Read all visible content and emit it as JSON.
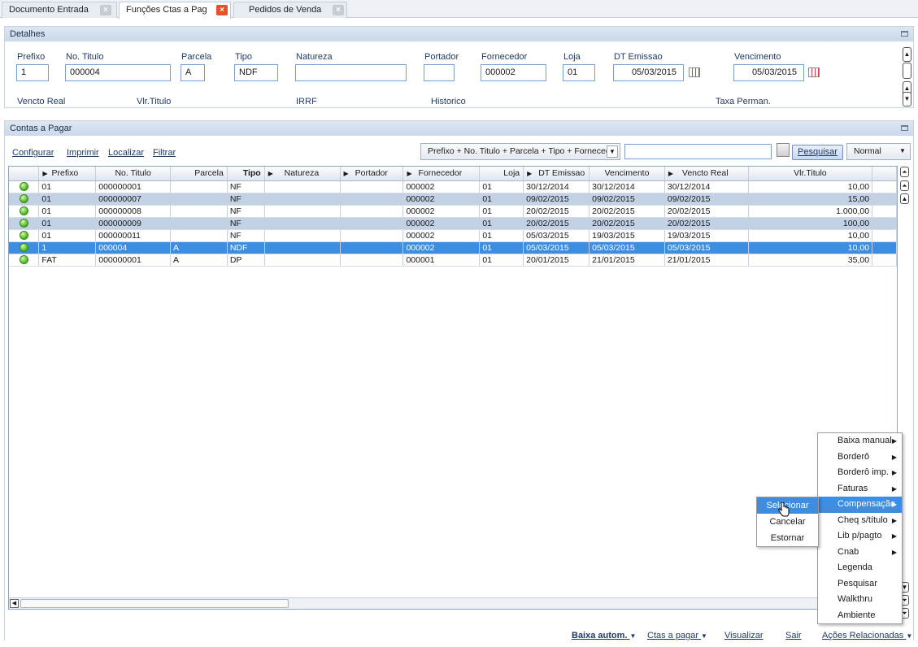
{
  "tabs": [
    {
      "label": "Documento Entrada"
    },
    {
      "label": "Funções Ctas a Pag"
    },
    {
      "label": "Pedidos de Venda"
    }
  ],
  "detalhes": {
    "title": "Detalhes",
    "fields": {
      "prefixo": {
        "label": "Prefixo",
        "value": "1"
      },
      "no_titulo": {
        "label": "No. Titulo",
        "value": "000004"
      },
      "parcela": {
        "label": "Parcela",
        "value": "A"
      },
      "tipo": {
        "label": "Tipo",
        "value": "NDF"
      },
      "natureza": {
        "label": "Natureza",
        "value": ""
      },
      "portador": {
        "label": "Portador",
        "value": ""
      },
      "fornecedor": {
        "label": "Fornecedor",
        "value": "000002"
      },
      "loja": {
        "label": "Loja",
        "value": "01"
      },
      "dt_emissao": {
        "label": "DT Emissao",
        "value": "05/03/2015"
      },
      "vencimento": {
        "label": "Vencimento",
        "value": "05/03/2015"
      }
    },
    "row2": {
      "vencto_real": "Vencto Real",
      "vlr_titulo": "Vlr.Titulo",
      "irrf": "IRRF",
      "historico": "Historico",
      "taxa_perman": "Taxa Perman."
    }
  },
  "contas": {
    "title": "Contas a Pagar",
    "links": {
      "configurar": "Configurar",
      "imprimir": "Imprimir",
      "localizar": "Localizar",
      "filtrar": "Filtrar"
    },
    "order_select": "Prefixo + No. Titulo + Parcela + Tipo + Fornecedo",
    "search_value": "",
    "search_button": "Pesquisar",
    "mode_select": "Normal"
  },
  "grid": {
    "columns": [
      "Prefixo",
      "No. Titulo",
      "Parcela",
      "Tipo",
      "Natureza",
      "Portador",
      "Fornecedor",
      "Loja",
      "DT Emissao",
      "Vencimento",
      "Vencto Real",
      "Vlr.Titulo"
    ],
    "rows": [
      [
        "01",
        "000000001",
        "",
        "NF",
        "",
        "",
        "000002",
        "01",
        "30/12/2014",
        "30/12/2014",
        "30/12/2014",
        "10,00"
      ],
      [
        "01",
        "000000007",
        "",
        "NF",
        "",
        "",
        "000002",
        "01",
        "09/02/2015",
        "09/02/2015",
        "09/02/2015",
        "15,00"
      ],
      [
        "01",
        "000000008",
        "",
        "NF",
        "",
        "",
        "000002",
        "01",
        "20/02/2015",
        "20/02/2015",
        "20/02/2015",
        "1.000,00"
      ],
      [
        "01",
        "000000009",
        "",
        "NF",
        "",
        "",
        "000002",
        "01",
        "20/02/2015",
        "20/02/2015",
        "20/02/2015",
        "100,00"
      ],
      [
        "01",
        "000000011",
        "",
        "NF",
        "",
        "",
        "000002",
        "01",
        "05/03/2015",
        "19/03/2015",
        "19/03/2015",
        "10,00"
      ],
      [
        "1",
        "000004",
        "A",
        "NDF",
        "",
        "",
        "000002",
        "01",
        "05/03/2015",
        "05/03/2015",
        "05/03/2015",
        "10,00"
      ],
      [
        "FAT",
        "000000001",
        "A",
        "DP",
        "",
        "",
        "000001",
        "01",
        "20/01/2015",
        "21/01/2015",
        "21/01/2015",
        "35,00"
      ]
    ],
    "selected_row": 5,
    "status_color": "#47b320"
  },
  "context_menu": {
    "items": [
      "Baixa manual",
      "Borderô",
      "Borderô imp.",
      "Faturas",
      "Compensação",
      "Cheq s/título",
      "Lib p/pagto",
      "Cnab",
      "Legenda",
      "Pesquisar",
      "Walkthru",
      "Ambiente"
    ],
    "submenu": [
      "Selecionar",
      "Cancelar",
      "Estornar"
    ]
  },
  "bottom_actions": {
    "baixa_autom": "Baixa autom.",
    "ctas_a_pagar": "Ctas a pagar",
    "visualizar": "Visualizar",
    "sair": "Sair",
    "acoes_relacionadas": "Ações Relacionadas"
  },
  "colors": {
    "accent": "#3d8de0",
    "alt_row": "#c2d1e4",
    "tab_close_active": "#e8502a"
  }
}
